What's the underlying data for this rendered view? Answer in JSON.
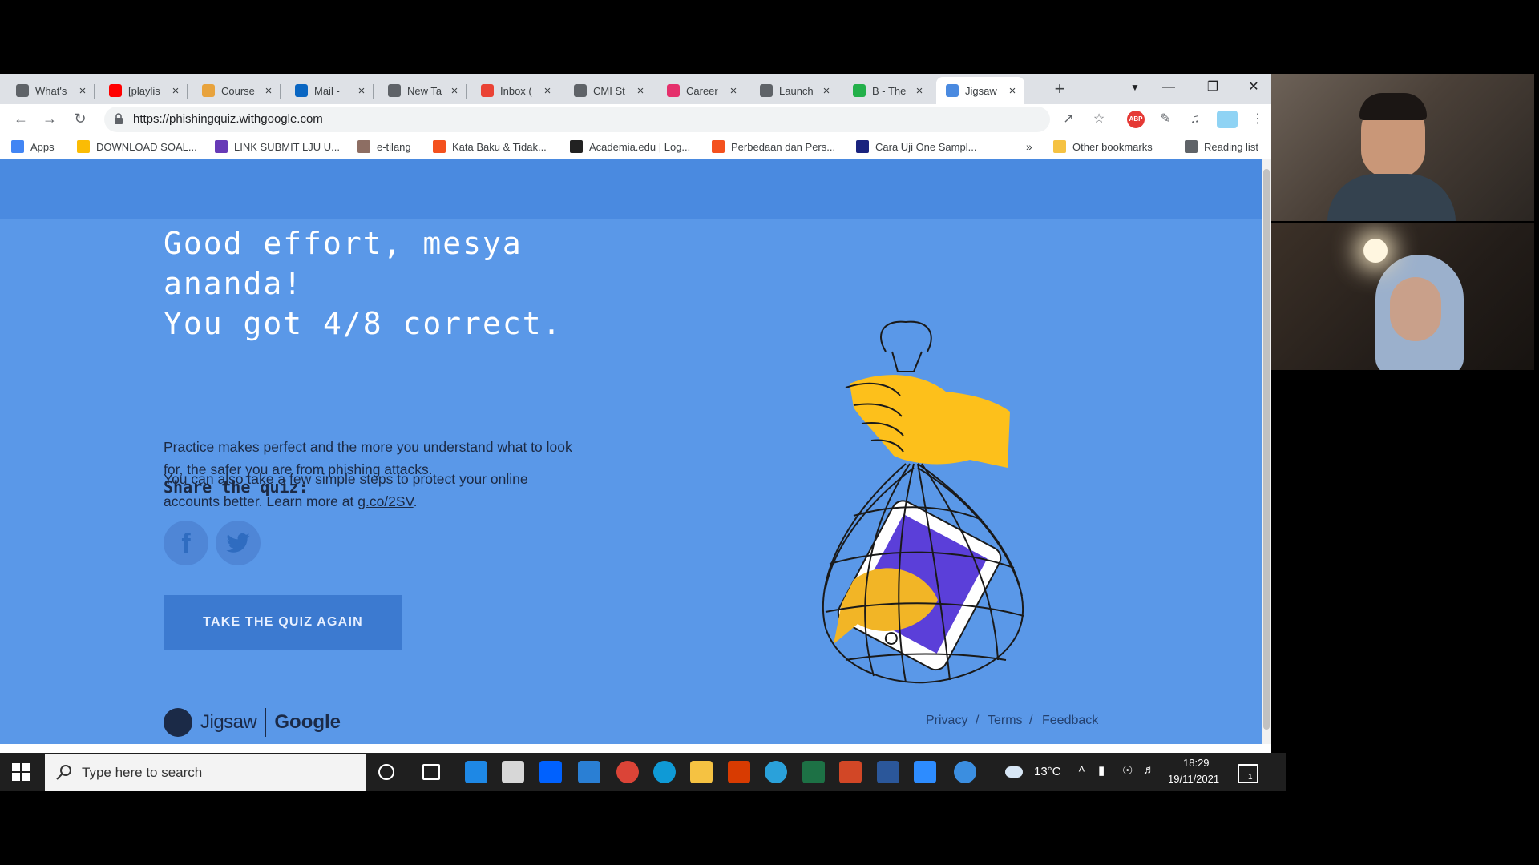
{
  "tabs": [
    {
      "label": "What's",
      "favicon_color": "#5f6368"
    },
    {
      "label": "[playlis",
      "favicon_color": "#ff0000"
    },
    {
      "label": "Course",
      "favicon_color": "#e8a33d"
    },
    {
      "label": "Mail - ",
      "favicon_color": "#0a66c2"
    },
    {
      "label": "New Ta",
      "favicon_color": "#5f6368"
    },
    {
      "label": "Inbox (",
      "favicon_color": "#ea4335"
    },
    {
      "label": "CMI St",
      "favicon_color": "#5f6368"
    },
    {
      "label": "Career",
      "favicon_color": "#e5306c"
    },
    {
      "label": "Launch",
      "favicon_color": "#5f6368"
    },
    {
      "label": "B - The",
      "favicon_color": "#23b04a"
    },
    {
      "label": "Jigsaw",
      "favicon_color": "#4a8ae0",
      "active": true
    }
  ],
  "address": {
    "url": "https://phishingquiz.withgoogle.com"
  },
  "bookmarks": [
    {
      "label": "Apps",
      "icon_color": "#4285f4"
    },
    {
      "label": "DOWNLOAD SOAL...",
      "icon_color": "#fbbc04"
    },
    {
      "label": "LINK SUBMIT LJU U...",
      "icon_color": "#673ab7"
    },
    {
      "label": "e-tilang",
      "icon_color": "#8d6e63"
    },
    {
      "label": "Kata Baku & Tidak...",
      "icon_color": "#f4511e"
    },
    {
      "label": "Academia.edu | Log...",
      "icon_color": "#222222"
    },
    {
      "label": "Perbedaan dan Pers...",
      "icon_color": "#f4511e"
    },
    {
      "label": "Cara Uji One Sampl...",
      "icon_color": "#1a237e"
    },
    {
      "label": "Other bookmarks",
      "icon_color": "#f5c242"
    },
    {
      "label": "Reading list",
      "icon_color": "#5f6368"
    }
  ],
  "page": {
    "headline_line1": "Good effort, mesya",
    "headline_line2": "ananda!",
    "headline_line3": "You got 4/8 correct.",
    "para1": "Practice makes perfect and the more you understand what to look for, the safer you are from phishing attacks.",
    "para2_prefix": "You can also take a few simple steps to protect your online accounts better. Learn more at ",
    "para2_link": "g.co/2SV",
    "para2_suffix": ".",
    "share_label": "Share the quiz:",
    "retake_button": "TAKE THE QUIZ AGAIN",
    "footer_brand": "Jigsaw",
    "footer_partner": "Google",
    "footer_links": [
      "Privacy",
      "Terms",
      "Feedback"
    ],
    "footer_separator": "/"
  },
  "taskbar": {
    "search_placeholder": "Type here to search",
    "weather": "13°C",
    "time": "18:29",
    "date": "19/11/2021",
    "notification_count": "1"
  }
}
